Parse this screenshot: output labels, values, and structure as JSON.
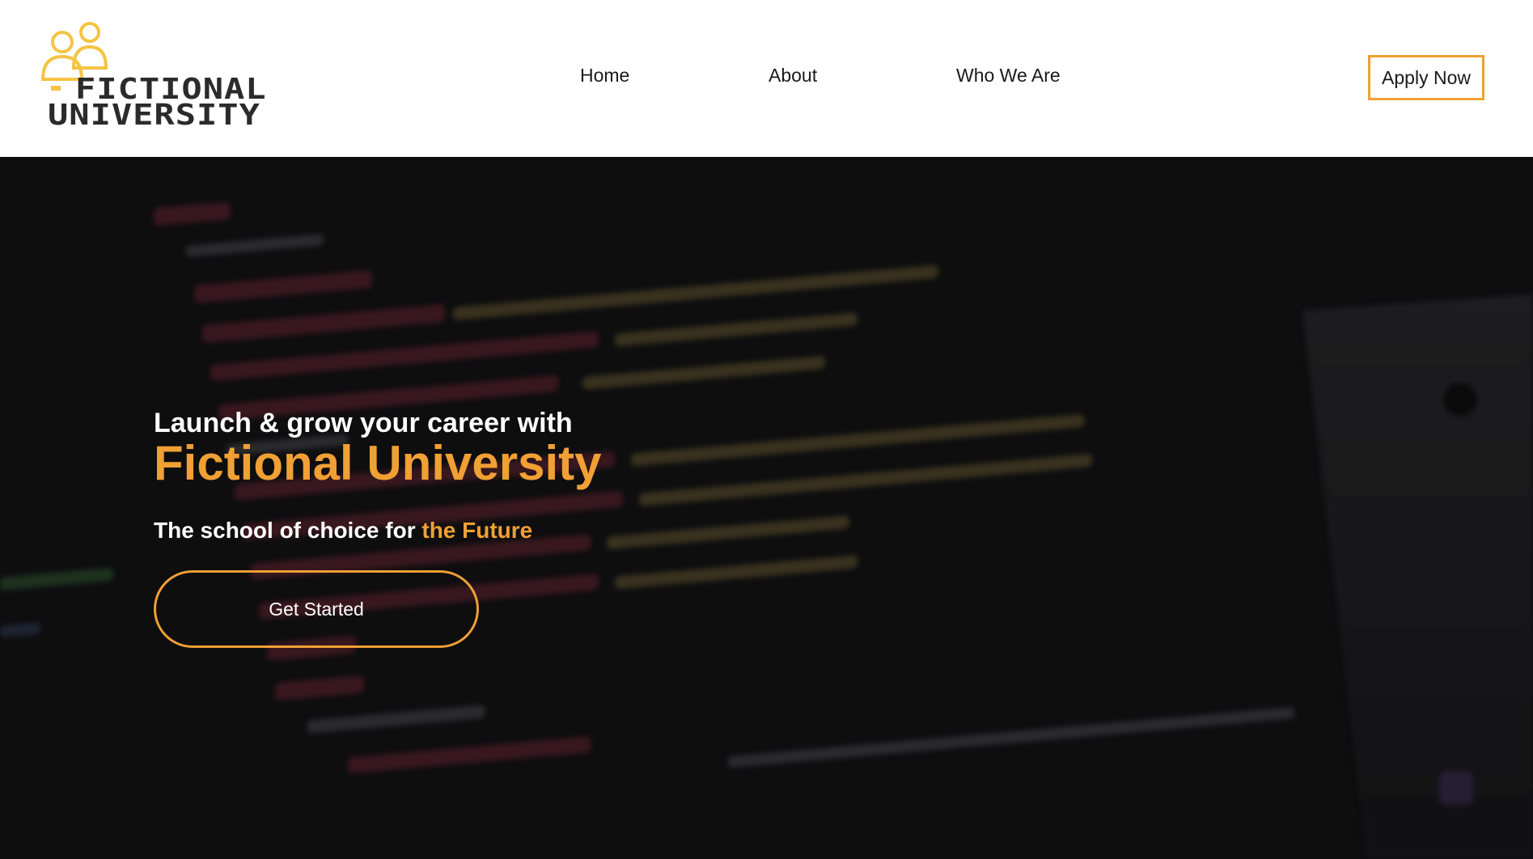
{
  "brand": {
    "logo_line1": "FICTIONAL",
    "logo_line2": "UNIVERSITY",
    "logo_icon": "people-icon",
    "accent_color": "#f0a034"
  },
  "nav": {
    "items": [
      {
        "label": "Home"
      },
      {
        "label": "About"
      },
      {
        "label": "Who We Are"
      }
    ],
    "apply_label": "Apply Now"
  },
  "hero": {
    "kicker": "Launch & grow your career with",
    "title": "Fictional University",
    "tagline_prefix": "The school of choice for ",
    "tagline_accent": "the Future",
    "cta_label": "Get Started"
  }
}
